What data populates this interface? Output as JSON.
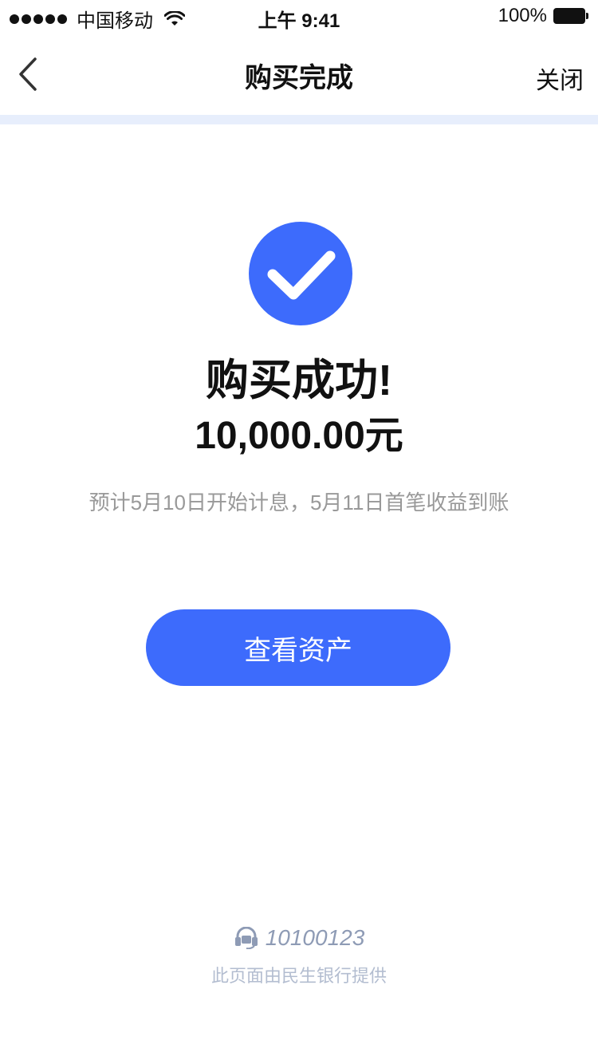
{
  "status_bar": {
    "carrier": "中国移动",
    "time": "上午 9:41",
    "battery": "100%"
  },
  "nav": {
    "title": "购买完成",
    "close_label": "关闭"
  },
  "result": {
    "title": "购买成功!",
    "amount": "10,000.00元",
    "note": "预计5月10日开始计息，5月11日首笔收益到账"
  },
  "actions": {
    "primary_label": "查看资产"
  },
  "footer": {
    "hotline": "10100123",
    "provider": "此页面由民生银行提供"
  },
  "colors": {
    "accent": "#3d6bfc",
    "divider": "#e7eefc",
    "muted_text": "#999999",
    "footer_text": "#8e9bb5"
  },
  "icons": {
    "back": "chevron-left-icon",
    "success": "check-circle-icon",
    "hotline": "headset-icon",
    "wifi": "wifi-icon",
    "battery": "battery-icon"
  }
}
